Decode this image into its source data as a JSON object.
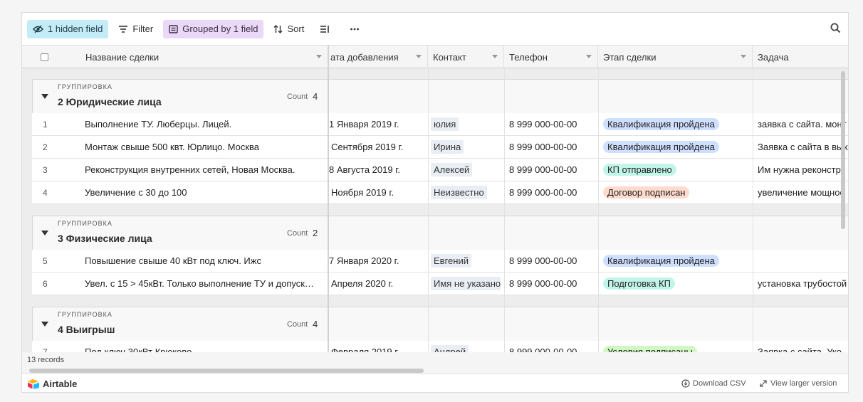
{
  "toolbar": {
    "hidden_fields": "1 hidden field",
    "filter": "Filter",
    "grouped": "Grouped by 1 field",
    "sort": "Sort"
  },
  "columns": {
    "name": "Название сделки",
    "date": "ата добавления",
    "contact": "Контакт",
    "phone": "Телефон",
    "stage": "Этап сделки",
    "task": "Задача"
  },
  "group_label": "ГРУППИРОВКА",
  "count_label": "Count",
  "groups": [
    {
      "title": "2 Юридические лица",
      "count": "4",
      "rows": [
        {
          "num": "1",
          "name": "Выполнение ТУ. Люберцы. Лицей.",
          "date": "1 Января 2019 г.",
          "contact": "юлия",
          "phone": "8 999 000-00-00",
          "stage": "Квалификация пройдена",
          "task": "заявка с сайта. монт"
        },
        {
          "num": "2",
          "name": "Монтаж свыше 500 квт. Юрлицо. Москва",
          "date": "Сентября 2019 г.",
          "contact": "Ирина",
          "phone": "8 999 000-00-00",
          "stage": "Квалификация пройдена",
          "task": "Заявка с сайта в вых"
        },
        {
          "num": "3",
          "name": "Реконструкция внутренних сетей, Новая Москва.",
          "date": "8 Августа 2019 г.",
          "contact": "Алексей",
          "phone": "8 999 000-00-00",
          "stage": "КП отправлено",
          "task": "Им нужна реконстру"
        },
        {
          "num": "4",
          "name": "Увеличение с 30 до 100",
          "date": "Ноября 2019 г.",
          "contact": "Неизвестно",
          "phone": "8 999 000-00-00",
          "stage": "Договор подписан",
          "task": "увеличение мощнос"
        }
      ]
    },
    {
      "title": "3 Физические лица",
      "count": "2",
      "rows": [
        {
          "num": "5",
          "name": "Повышение свыше 40 кВт под ключ. Ижс",
          "date": "7 Января 2020 г.",
          "contact": "Евгений",
          "phone": "8 999 000-00-00",
          "stage": "Квалификация пройдена",
          "task": ""
        },
        {
          "num": "6",
          "name": "Увел. с 15 > 45кВт. Только выполнение ТУ и допуск…",
          "date": "Апреля 2020 г.",
          "contact": "Имя не указано",
          "phone": "8 999 000-00-00",
          "stage": "Подготовка КП",
          "task": "установка трубостой"
        }
      ]
    },
    {
      "title": "4 Выигрыш",
      "count": "4",
      "rows": [
        {
          "num": "7",
          "name": "Под ключ 30кВт Крюково",
          "date": "Февраля 2019 г.",
          "contact": "Андрей",
          "phone": "8 999 000-00-00",
          "stage": "Условия подписаны",
          "task": "Заявка с сайта. Уко"
        }
      ]
    }
  ],
  "stage_colors": {
    "Квалификация пройдена": "#cfdfff",
    "КП отправлено": "#c2f5e9",
    "Договор подписан": "#ffdace",
    "Подготовка КП": "#c2f5e9",
    "Условия подписаны": "#d1f7c4"
  },
  "records": "13 records",
  "footer": {
    "brand": "Airtable",
    "download": "Download CSV",
    "larger": "View larger version"
  }
}
